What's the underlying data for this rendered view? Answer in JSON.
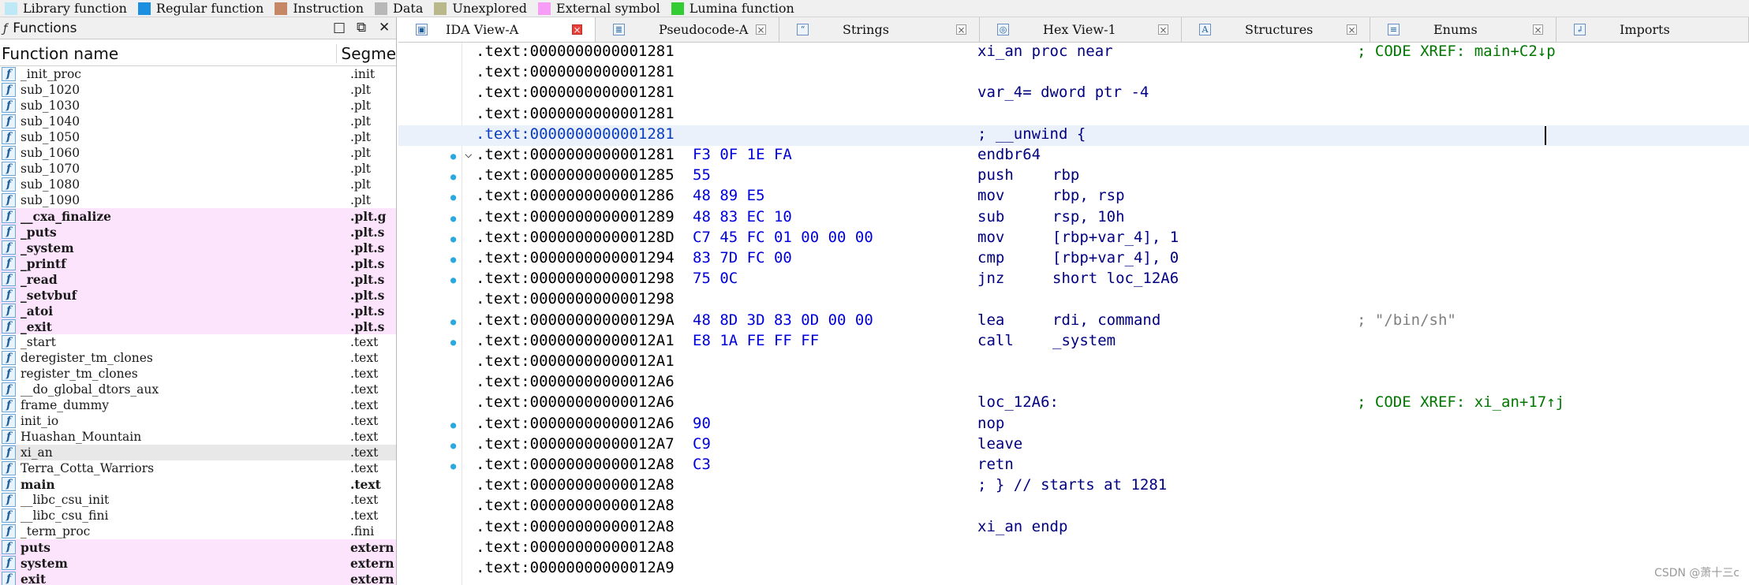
{
  "legend": [
    {
      "label": "Library function",
      "color": "#bfe8f6"
    },
    {
      "label": "Regular function",
      "color": "#1d8fe0"
    },
    {
      "label": "Instruction",
      "color": "#c58766"
    },
    {
      "label": "Data",
      "color": "#b8b8b8"
    },
    {
      "label": "Unexplored",
      "color": "#b8b88a"
    },
    {
      "label": "External symbol",
      "color": "#f79cf7"
    },
    {
      "label": "Lumina function",
      "color": "#33cc33"
    }
  ],
  "functions_panel": {
    "title": "Functions",
    "col_name": "Function name",
    "col_segment": "Segme",
    "rows": [
      {
        "name": "_init_proc",
        "seg": ".init",
        "style": ""
      },
      {
        "name": "sub_1020",
        "seg": ".plt",
        "style": ""
      },
      {
        "name": "sub_1030",
        "seg": ".plt",
        "style": ""
      },
      {
        "name": "sub_1040",
        "seg": ".plt",
        "style": ""
      },
      {
        "name": "sub_1050",
        "seg": ".plt",
        "style": ""
      },
      {
        "name": "sub_1060",
        "seg": ".plt",
        "style": ""
      },
      {
        "name": "sub_1070",
        "seg": ".plt",
        "style": ""
      },
      {
        "name": "sub_1080",
        "seg": ".plt",
        "style": ""
      },
      {
        "name": "sub_1090",
        "seg": ".plt",
        "style": ""
      },
      {
        "name": "__cxa_finalize",
        "seg": ".plt.g",
        "style": "ext bold"
      },
      {
        "name": "_puts",
        "seg": ".plt.s",
        "style": "ext bold"
      },
      {
        "name": "_system",
        "seg": ".plt.s",
        "style": "ext bold"
      },
      {
        "name": "_printf",
        "seg": ".plt.s",
        "style": "ext bold"
      },
      {
        "name": "_read",
        "seg": ".plt.s",
        "style": "ext bold"
      },
      {
        "name": "_setvbuf",
        "seg": ".plt.s",
        "style": "ext bold"
      },
      {
        "name": "_atoi",
        "seg": ".plt.s",
        "style": "ext bold"
      },
      {
        "name": "_exit",
        "seg": ".plt.s",
        "style": "ext bold"
      },
      {
        "name": "_start",
        "seg": ".text",
        "style": ""
      },
      {
        "name": "deregister_tm_clones",
        "seg": ".text",
        "style": ""
      },
      {
        "name": "register_tm_clones",
        "seg": ".text",
        "style": ""
      },
      {
        "name": "__do_global_dtors_aux",
        "seg": ".text",
        "style": ""
      },
      {
        "name": "frame_dummy",
        "seg": ".text",
        "style": ""
      },
      {
        "name": "init_io",
        "seg": ".text",
        "style": ""
      },
      {
        "name": "Huashan_Mountain",
        "seg": ".text",
        "style": ""
      },
      {
        "name": "xi_an",
        "seg": ".text",
        "style": "sel"
      },
      {
        "name": "Terra_Cotta_Warriors",
        "seg": ".text",
        "style": ""
      },
      {
        "name": "main",
        "seg": ".text",
        "style": "bold"
      },
      {
        "name": "__libc_csu_init",
        "seg": ".text",
        "style": ""
      },
      {
        "name": "__libc_csu_fini",
        "seg": ".text",
        "style": ""
      },
      {
        "name": "_term_proc",
        "seg": ".fini",
        "style": ""
      },
      {
        "name": "puts",
        "seg": "extern",
        "style": "ext bold"
      },
      {
        "name": "system",
        "seg": "extern",
        "style": "ext bold"
      },
      {
        "name": "exit",
        "seg": "extern",
        "style": "ext bold"
      }
    ]
  },
  "tabs": [
    {
      "label": "IDA View-A",
      "icon": "ida-view-icon",
      "active": true
    },
    {
      "label": "Pseudocode-A",
      "icon": "pseudocode-icon",
      "active": false
    },
    {
      "label": "Strings",
      "icon": "strings-icon",
      "active": false
    },
    {
      "label": "Hex View-1",
      "icon": "hex-view-icon",
      "active": false
    },
    {
      "label": "Structures",
      "icon": "structures-icon",
      "active": false
    },
    {
      "label": "Enums",
      "icon": "enums-icon",
      "active": false
    },
    {
      "label": "Imports",
      "icon": "imports-icon",
      "active": false
    }
  ],
  "disassembly": [
    {
      "addr": ".text:0000000000001281",
      "bytes": "",
      "op": "xi_an proc near",
      "arg": "",
      "cmt": "; CODE XREF: main+C2↓p",
      "cmt_kind": "xref"
    },
    {
      "addr": ".text:0000000000001281",
      "bytes": "",
      "op": "",
      "arg": "",
      "cmt": ""
    },
    {
      "addr": ".text:0000000000001281",
      "bytes": "",
      "op": "var_4= dword ptr -4",
      "arg": "",
      "cmt": "",
      "op_kind": "var"
    },
    {
      "addr": ".text:0000000000001281",
      "bytes": "",
      "op": "",
      "arg": "",
      "cmt": ""
    },
    {
      "addr": ".text:0000000000001281",
      "bytes": "",
      "op": "; __unwind {",
      "arg": "",
      "cmt": "",
      "hl": true
    },
    {
      "addr": ".text:0000000000001281",
      "bytes": "F3 0F 1E FA",
      "op": "endbr64",
      "arg": "",
      "cmt": "",
      "dot": true,
      "chev": true
    },
    {
      "addr": ".text:0000000000001285",
      "bytes": "55",
      "op": "push",
      "arg": "rbp",
      "cmt": "",
      "dot": true
    },
    {
      "addr": ".text:0000000000001286",
      "bytes": "48 89 E5",
      "op": "mov",
      "arg": "rbp, rsp",
      "cmt": "",
      "dot": true
    },
    {
      "addr": ".text:0000000000001289",
      "bytes": "48 83 EC 10",
      "op": "sub",
      "arg": "rsp, 10h",
      "cmt": "",
      "dot": true
    },
    {
      "addr": ".text:000000000000128D",
      "bytes": "C7 45 FC 01 00 00 00",
      "op": "mov",
      "arg": "[rbp+var_4], 1",
      "cmt": "",
      "dot": true
    },
    {
      "addr": ".text:0000000000001294",
      "bytes": "83 7D FC 00",
      "op": "cmp",
      "arg": "[rbp+var_4], 0",
      "cmt": "",
      "dot": true
    },
    {
      "addr": ".text:0000000000001298",
      "bytes": "75 0C",
      "op": "jnz",
      "arg": "short loc_12A6",
      "cmt": "",
      "dot": true
    },
    {
      "addr": ".text:0000000000001298",
      "bytes": "",
      "op": "",
      "arg": "",
      "cmt": ""
    },
    {
      "addr": ".text:000000000000129A",
      "bytes": "48 8D 3D 83 0D 00 00",
      "op": "lea",
      "arg": "rdi, command",
      "cmt": "; \"/bin/sh\"",
      "dot": true
    },
    {
      "addr": ".text:00000000000012A1",
      "bytes": "E8 1A FE FF FF",
      "op": "call",
      "arg": "_system",
      "cmt": "",
      "dot": true
    },
    {
      "addr": ".text:00000000000012A1",
      "bytes": "",
      "op": "",
      "arg": "",
      "cmt": ""
    },
    {
      "addr": ".text:00000000000012A6",
      "bytes": "",
      "op": "",
      "arg": "",
      "cmt": ""
    },
    {
      "addr": ".text:00000000000012A6",
      "bytes": "",
      "op": "loc_12A6:",
      "arg": "",
      "cmt": "; CODE XREF: xi_an+17↑j",
      "cmt_kind": "xref"
    },
    {
      "addr": ".text:00000000000012A6",
      "bytes": "90",
      "op": "nop",
      "arg": "",
      "cmt": "",
      "dot": true
    },
    {
      "addr": ".text:00000000000012A7",
      "bytes": "C9",
      "op": "leave",
      "arg": "",
      "cmt": "",
      "dot": true
    },
    {
      "addr": ".text:00000000000012A8",
      "bytes": "C3",
      "op": "retn",
      "arg": "",
      "cmt": "",
      "dot": true
    },
    {
      "addr": ".text:00000000000012A8",
      "bytes": "",
      "op": "; } // starts at 1281",
      "arg": "",
      "cmt": ""
    },
    {
      "addr": ".text:00000000000012A8",
      "bytes": "",
      "op": "",
      "arg": "",
      "cmt": ""
    },
    {
      "addr": ".text:00000000000012A8",
      "bytes": "",
      "op": "xi_an endp",
      "arg": "",
      "cmt": ""
    },
    {
      "addr": ".text:00000000000012A8",
      "bytes": "",
      "op": "",
      "arg": "",
      "cmt": ""
    },
    {
      "addr": ".text:00000000000012A9",
      "bytes": "",
      "op": "",
      "arg": "",
      "cmt": ""
    }
  ],
  "watermark": "CSDN @萧十三c"
}
